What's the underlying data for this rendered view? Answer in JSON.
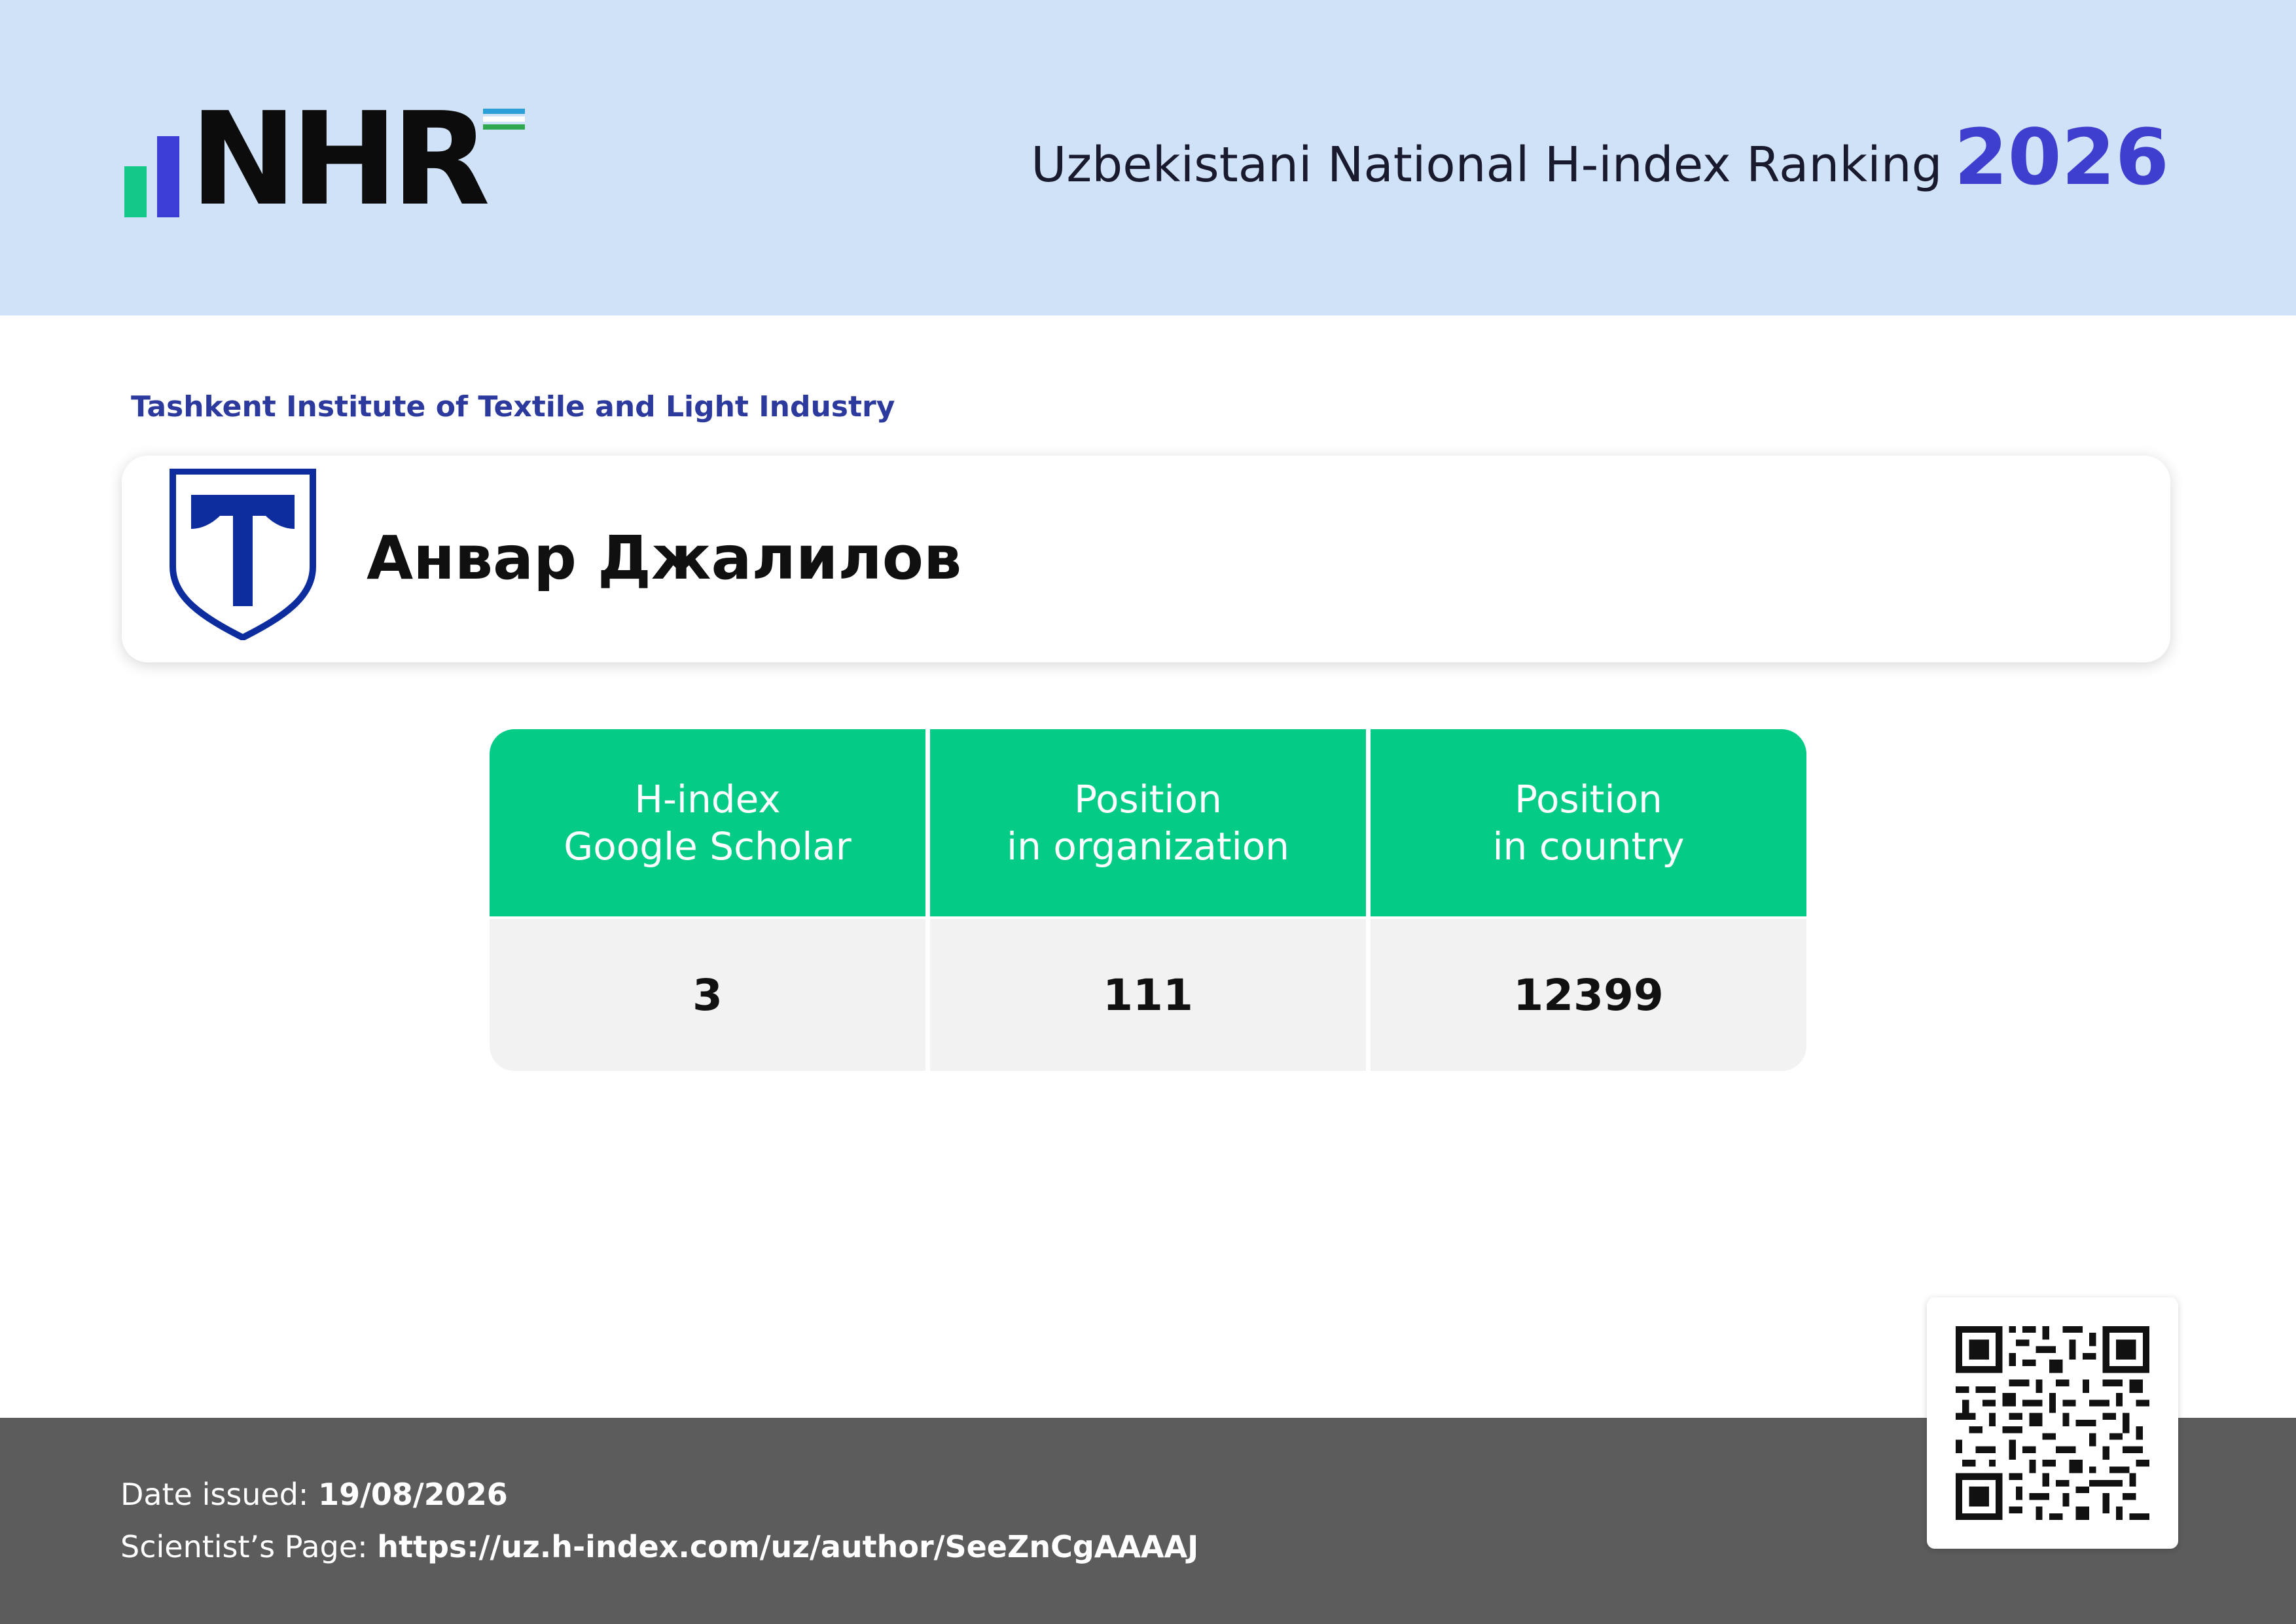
{
  "header": {
    "logo_text": "NHR",
    "title": "Uzbekistani National H-index Ranking",
    "year": "2026",
    "accent_color": "#3f3fcf",
    "background_color": "#cfe2f8"
  },
  "organization": {
    "name": "Tashkent Institute of Textile and Light Industry",
    "logo_icon": "shield-t-icon"
  },
  "person": {
    "name": "Анвар Джалилов"
  },
  "stats": {
    "header_color": "#04cc87",
    "columns": [
      {
        "label_line1": "H-index",
        "label_line2": "Google Scholar",
        "value": "3"
      },
      {
        "label_line1": "Position",
        "label_line2": "in organization",
        "value": "111"
      },
      {
        "label_line1": "Position",
        "label_line2": "in country",
        "value": "12399"
      }
    ]
  },
  "footer": {
    "date_label": "Date issued:",
    "date_value": "19/08/2026",
    "page_label": "Scientist’s Page:",
    "page_url": "https://uz.h-index.com/uz/author/SeeZnCgAAAAJ",
    "qr_icon": "qr-code-icon"
  }
}
